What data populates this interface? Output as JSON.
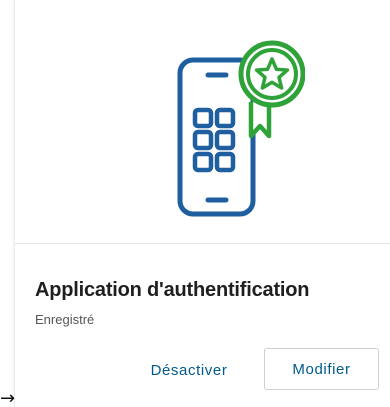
{
  "card": {
    "title": "Application d'authentification",
    "status": "Enregistré",
    "icon": "authenticator-phone-badge-icon",
    "colors": {
      "phone": "#1f5fa0",
      "badge": "#2fa33a",
      "action_text": "#005a8c"
    }
  },
  "actions": {
    "deactivate_label": "Désactiver",
    "modify_label": "Modifier"
  },
  "pointer": {
    "glyph": "→"
  }
}
